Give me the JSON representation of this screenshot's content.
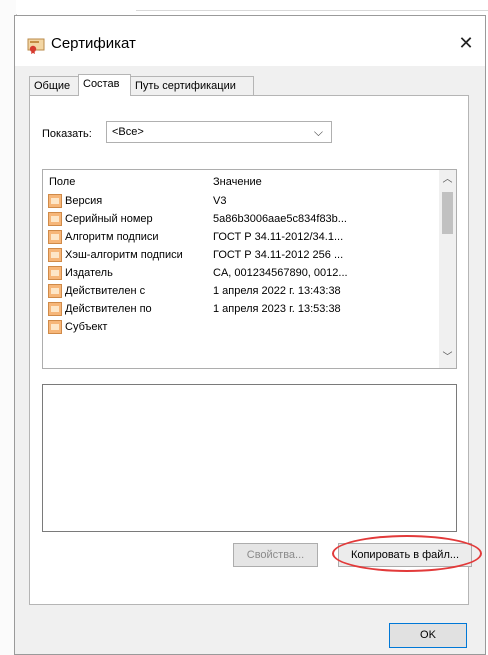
{
  "window": {
    "title": "Сертификат"
  },
  "tabs": [
    {
      "label": "Общие"
    },
    {
      "label": "Состав"
    },
    {
      "label": "Путь сертификации"
    }
  ],
  "show": {
    "label": "Показать:",
    "value": "<Все>"
  },
  "list": {
    "header_field": "Поле",
    "header_value": "Значение",
    "rows": [
      {
        "field": "Версия",
        "value": "V3"
      },
      {
        "field": "Серийный номер",
        "value": "5a86b3006aae5c834f83b..."
      },
      {
        "field": "Алгоритм подписи",
        "value": "ГОСТ Р 34.11-2012/34.1..."
      },
      {
        "field": "Хэш-алгоритм подписи",
        "value": "ГОСТ Р 34.11-2012 256 ..."
      },
      {
        "field": "Издатель",
        "value": "CA, 001234567890, 0012..."
      },
      {
        "field": "Действителен с",
        "value": "1 апреля 2022 г. 13:43:38"
      },
      {
        "field": "Действителен по",
        "value": "1 апреля 2023 г. 13:53:38"
      },
      {
        "field": "Субъект",
        "value": ""
      }
    ]
  },
  "buttons": {
    "properties": "Свойства...",
    "copy_to_file": "Копировать в файл...",
    "ok": "OK"
  },
  "colors": {
    "highlight_circle": "#e23a3a",
    "focus_border": "#0078d7"
  }
}
